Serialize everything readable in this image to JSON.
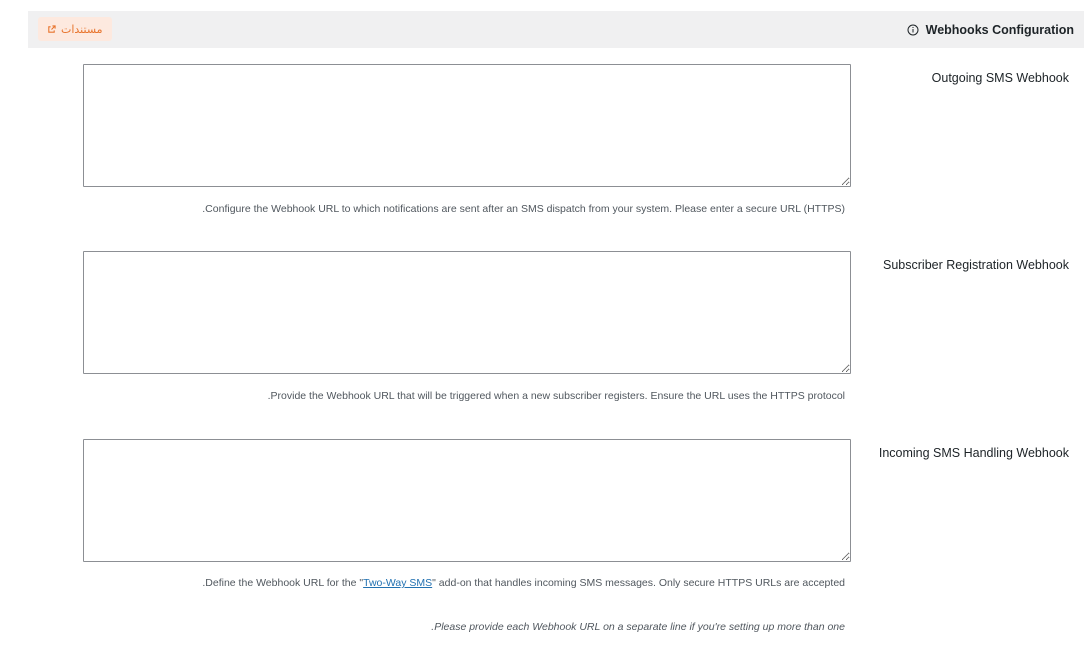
{
  "header": {
    "title": "Webhooks Configuration",
    "info_icon": "info-icon",
    "docs_label": "مستندات",
    "docs_icon": "external-link-icon",
    "accent_color": "#e8742d",
    "accent_bg": "#fde9df"
  },
  "fields": [
    {
      "label": "Outgoing SMS Webhook",
      "value": "",
      "description": ".Configure the Webhook URL to which notifications are sent after an SMS dispatch from your system. Please enter a secure URL (HTTPS)"
    },
    {
      "label": "Subscriber Registration Webhook",
      "value": "",
      "description": ".Provide the Webhook URL that will be triggered when a new subscriber registers. Ensure the URL uses the HTTPS protocol"
    },
    {
      "label": "Incoming SMS Handling Webhook",
      "value": "",
      "description_prefix": ".Define the Webhook URL for the \"",
      "description_link": "Two-Way SMS",
      "description_suffix": "\" add-on that handles incoming SMS messages. Only secure HTTPS URLs are accepted"
    }
  ],
  "footnote": ".Please provide each Webhook URL on a separate line if you're setting up more than one"
}
